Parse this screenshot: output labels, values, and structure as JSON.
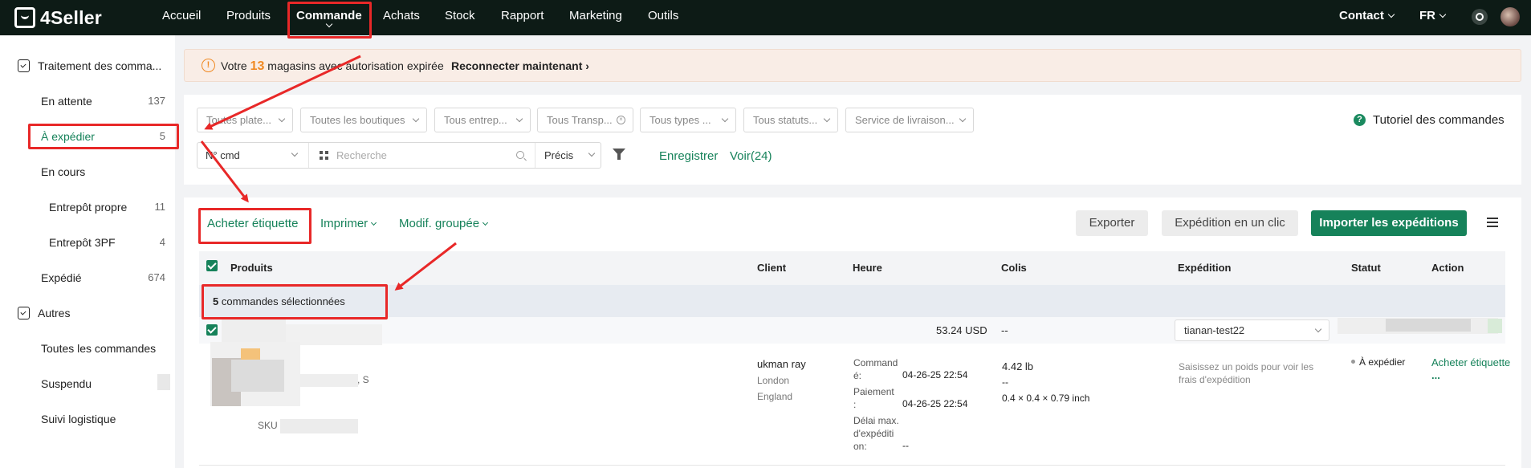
{
  "topnav": {
    "logo": "4Seller",
    "items": [
      "Accueil",
      "Produits",
      "Commande",
      "Achats",
      "Stock",
      "Rapport",
      "Marketing",
      "Outils"
    ],
    "contact": "Contact",
    "lang": "FR"
  },
  "sidebar": {
    "group1": "Traitement des comma...",
    "items": [
      {
        "label": "En attente",
        "count": "137"
      },
      {
        "label": "À expédier",
        "count": "5"
      },
      {
        "label": "En cours",
        "count": ""
      },
      {
        "label": "Entrepôt propre",
        "count": "11"
      },
      {
        "label": "Entrepôt 3PF",
        "count": "4"
      },
      {
        "label": "Expédié",
        "count": "674"
      }
    ],
    "group2": "Autres",
    "others": [
      "Toutes les commandes",
      "Suspendu",
      "Suivi logistique"
    ]
  },
  "alert": {
    "pre": "Votre ",
    "count": "13",
    "post": " magasins avec autorisation expirée",
    "link": "Reconnecter maintenant"
  },
  "filters": {
    "selects": [
      "Toutes plate...",
      "Toutes les boutiques",
      "Tous entrep...",
      "Tous Transp...",
      "Tous types ...",
      "Tous statuts...",
      "Service de livraison..."
    ],
    "search_type": "N° cmd",
    "search_placeholder": "Recherche",
    "match": "Précis",
    "save": "Enregistrer",
    "view": "Voir(24)",
    "tutorial": "Tutoriel des commandes"
  },
  "actions": {
    "buy_label": "Acheter étiquette",
    "print": "Imprimer",
    "bulk_edit": "Modif. groupée",
    "export": "Exporter",
    "one_click": "Expédition en un clic",
    "import": "Importer les expéditions"
  },
  "table": {
    "headers": [
      "Produits",
      "Client",
      "Heure",
      "Colis",
      "Expédition",
      "Statut",
      "Action"
    ],
    "selected_count": "5",
    "selected_text": " commandes sélectionnées",
    "group_row": {
      "amount": "53.24 USD",
      "colis": "--",
      "carrier": "tianan-test22"
    },
    "order": {
      "sku_label": "SKU",
      "client": [
        "ukman ray",
        "London",
        "England"
      ],
      "time_labels": [
        "Command\né:",
        "Paiement\n:",
        "Délai max.\nd'expéditi\non:"
      ],
      "time_values": [
        "04-26-25 22:54",
        "04-26-25 22:54",
        "--"
      ],
      "weight": "4.42 lb",
      "dash": "--",
      "dims": "0.4 × 0.4 × 0.79 inch",
      "ship_hint": "Saisissez un poids pour voir les frais d'expédition",
      "status": "À expédier",
      "action": "Acheter étiquette",
      "more": "..."
    }
  },
  "colors": {
    "brand_green": "#16825a",
    "topbar": "#0d1b16",
    "annotation_red": "#e82828",
    "alert_orange": "#f08a24"
  }
}
